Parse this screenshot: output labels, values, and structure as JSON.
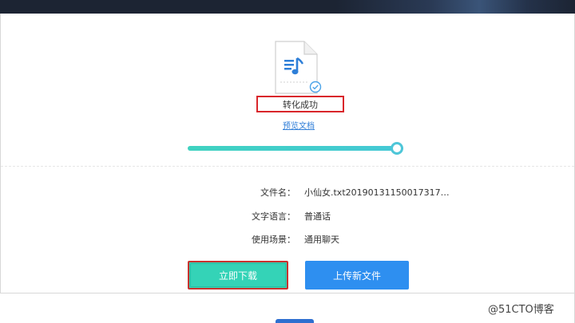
{
  "status": {
    "text": "转化成功"
  },
  "preview": {
    "link_label": "预览文档"
  },
  "progress": {
    "percent": 100
  },
  "details": {
    "file_name_label": "文件名：",
    "file_name_value": "小仙女.txt20190131150017317…",
    "language_label": "文字语言：",
    "language_value": "普通话",
    "scene_label": "使用场景：",
    "scene_value": "通用聊天"
  },
  "buttons": {
    "download_label": "立即下载",
    "upload_label": "上传新文件"
  },
  "watermark": {
    "text": "@51CTO博客"
  },
  "colors": {
    "accent_teal": "#34d3b7",
    "accent_blue": "#2e8ff0",
    "highlight_red": "#d9262b"
  },
  "icons": {
    "file": "audio-file-icon",
    "check": "check-circle-icon"
  }
}
